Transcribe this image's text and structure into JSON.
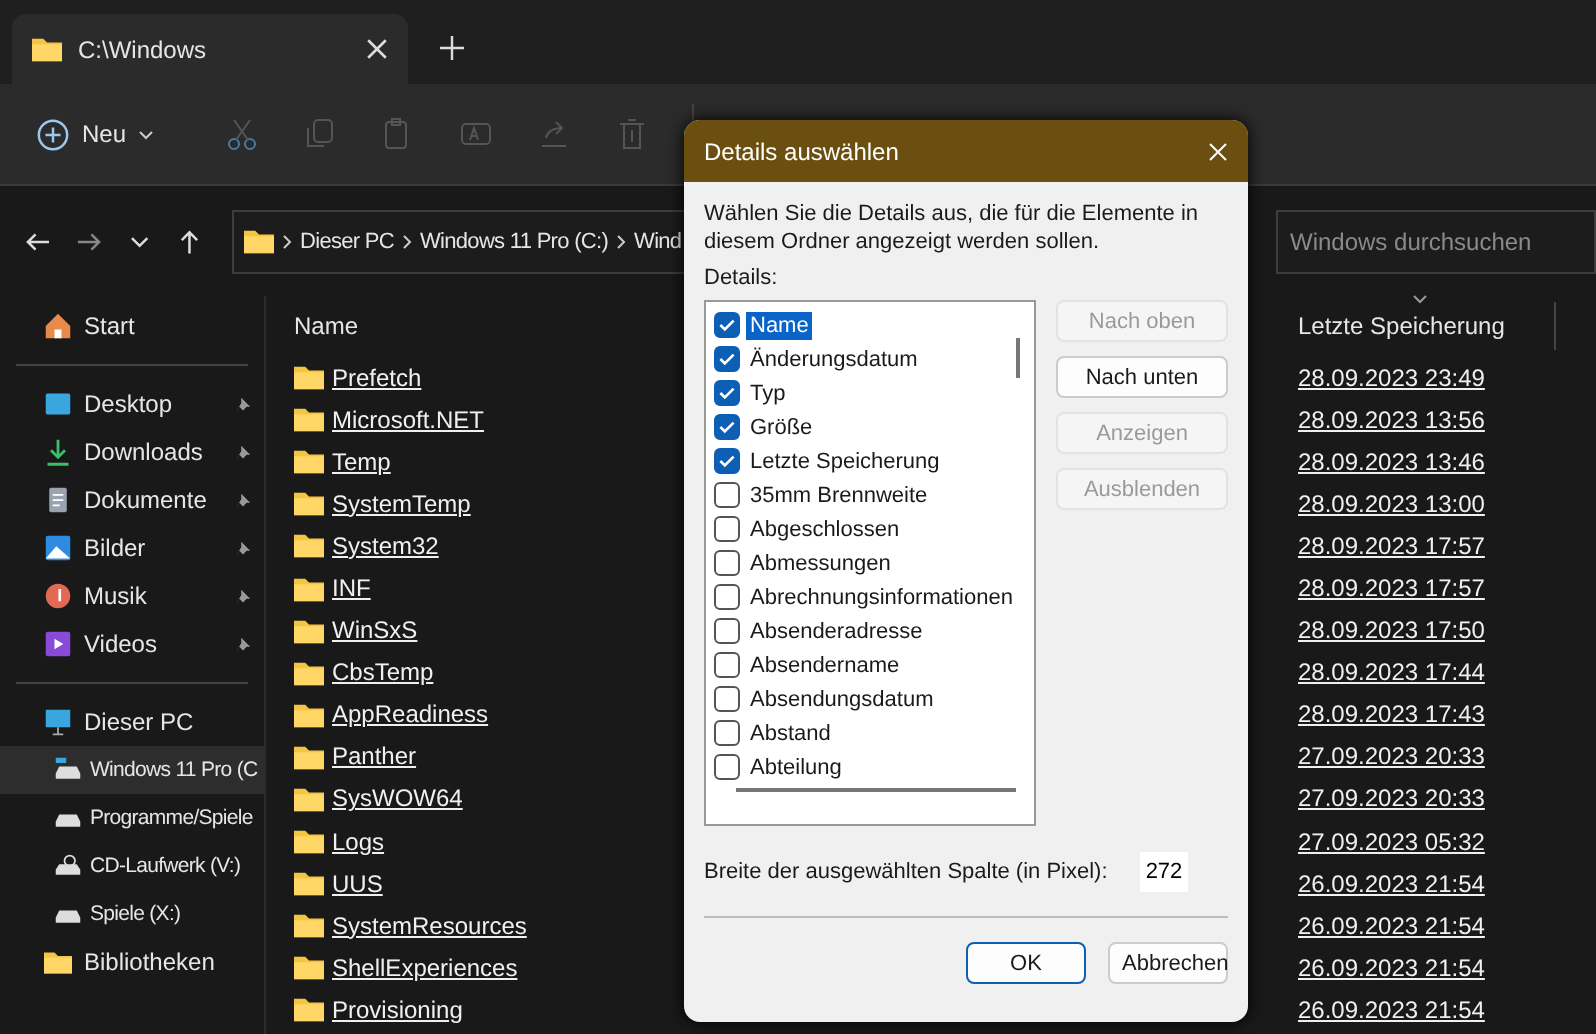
{
  "tab": {
    "title": "C:\\Windows"
  },
  "toolbar": {
    "new_label": "Neu"
  },
  "address": {
    "crumbs": [
      "Dieser PC",
      "Windows 11 Pro (C:)",
      "Wind"
    ]
  },
  "search": {
    "placeholder": "Windows durchsuchen"
  },
  "sidebar": {
    "sections": [
      {
        "items": [
          {
            "label": "Start",
            "kind": "home",
            "pinned": false,
            "selected": false
          }
        ]
      },
      {
        "items": [
          {
            "label": "Desktop",
            "kind": "desktop",
            "pinned": true,
            "selected": false
          },
          {
            "label": "Downloads",
            "kind": "download",
            "pinned": true,
            "selected": false
          },
          {
            "label": "Dokumente",
            "kind": "document",
            "pinned": true,
            "selected": false
          },
          {
            "label": "Bilder",
            "kind": "picture",
            "pinned": true,
            "selected": false
          },
          {
            "label": "Musik",
            "kind": "music",
            "pinned": true,
            "selected": false
          },
          {
            "label": "Videos",
            "kind": "video",
            "pinned": true,
            "selected": false
          }
        ]
      },
      {
        "items": [
          {
            "label": "Dieser PC",
            "kind": "pc",
            "pinned": false,
            "selected": false,
            "children": [
              {
                "label": "Windows 11 Pro (C",
                "kind": "system-drive",
                "selected": true
              },
              {
                "label": "Programme/Spiele",
                "kind": "drive",
                "selected": false
              },
              {
                "label": "CD-Laufwerk (V:)",
                "kind": "cd",
                "selected": false
              },
              {
                "label": "Spiele (X:)",
                "kind": "drive",
                "selected": false
              }
            ]
          },
          {
            "label": "Bibliotheken",
            "kind": "library",
            "pinned": false,
            "selected": false
          }
        ]
      }
    ]
  },
  "file_list": {
    "columns": [
      "Name",
      "Letzte Speicherung"
    ],
    "rows": [
      {
        "name": "Prefetch",
        "date": "28.09.2023 23:49"
      },
      {
        "name": "Microsoft.NET",
        "date": "28.09.2023 13:56"
      },
      {
        "name": "Temp",
        "date": "28.09.2023 13:46"
      },
      {
        "name": "SystemTemp",
        "date": "28.09.2023 13:00"
      },
      {
        "name": "System32",
        "date": "28.09.2023 17:57"
      },
      {
        "name": "INF",
        "date": "28.09.2023 17:57"
      },
      {
        "name": "WinSxS",
        "date": "28.09.2023 17:50"
      },
      {
        "name": "CbsTemp",
        "date": "28.09.2023 17:44"
      },
      {
        "name": "AppReadiness",
        "date": "28.09.2023 17:43"
      },
      {
        "name": "Panther",
        "date": "27.09.2023 20:33"
      },
      {
        "name": "SysWOW64",
        "date": "27.09.2023 20:33"
      },
      {
        "name": "Logs",
        "date": "27.09.2023 05:32"
      },
      {
        "name": "UUS",
        "date": "26.09.2023 21:54"
      },
      {
        "name": "SystemResources",
        "date": "26.09.2023 21:54"
      },
      {
        "name": "ShellExperiences",
        "date": "26.09.2023 21:54"
      },
      {
        "name": "Provisioning",
        "date": "26.09.2023 21:54"
      }
    ]
  },
  "dialog": {
    "title": "Details auswählen",
    "description": "Wählen Sie die Details aus, die für die Elemente in diesem Ordner angezeigt werden sollen.",
    "details_label": "Details:",
    "items": [
      {
        "label": "Name",
        "checked": true,
        "selected": true
      },
      {
        "label": "Änderungsdatum",
        "checked": true,
        "selected": false
      },
      {
        "label": "Typ",
        "checked": true,
        "selected": false
      },
      {
        "label": "Größe",
        "checked": true,
        "selected": false
      },
      {
        "label": "Letzte Speicherung",
        "checked": true,
        "selected": false
      },
      {
        "label": "35mm Brennweite",
        "checked": false,
        "selected": false
      },
      {
        "label": "Abgeschlossen",
        "checked": false,
        "selected": false
      },
      {
        "label": "Abmessungen",
        "checked": false,
        "selected": false
      },
      {
        "label": "Abrechnungsinformationen",
        "checked": false,
        "selected": false
      },
      {
        "label": "Absenderadresse",
        "checked": false,
        "selected": false
      },
      {
        "label": "Absendername",
        "checked": false,
        "selected": false
      },
      {
        "label": "Absendungsdatum",
        "checked": false,
        "selected": false
      },
      {
        "label": "Abstand",
        "checked": false,
        "selected": false
      },
      {
        "label": "Abteilung",
        "checked": false,
        "selected": false
      }
    ],
    "side_buttons": [
      {
        "label": "Nach oben",
        "disabled": true
      },
      {
        "label": "Nach unten",
        "disabled": false
      },
      {
        "label": "Anzeigen",
        "disabled": true
      },
      {
        "label": "Ausblenden",
        "disabled": true
      }
    ],
    "width_label": "Breite der ausgewählten Spalte (in Pixel):",
    "width_value": "272",
    "footer_buttons": [
      {
        "label": "OK",
        "default": true
      },
      {
        "label": "Abbrechen",
        "default": false
      }
    ]
  }
}
